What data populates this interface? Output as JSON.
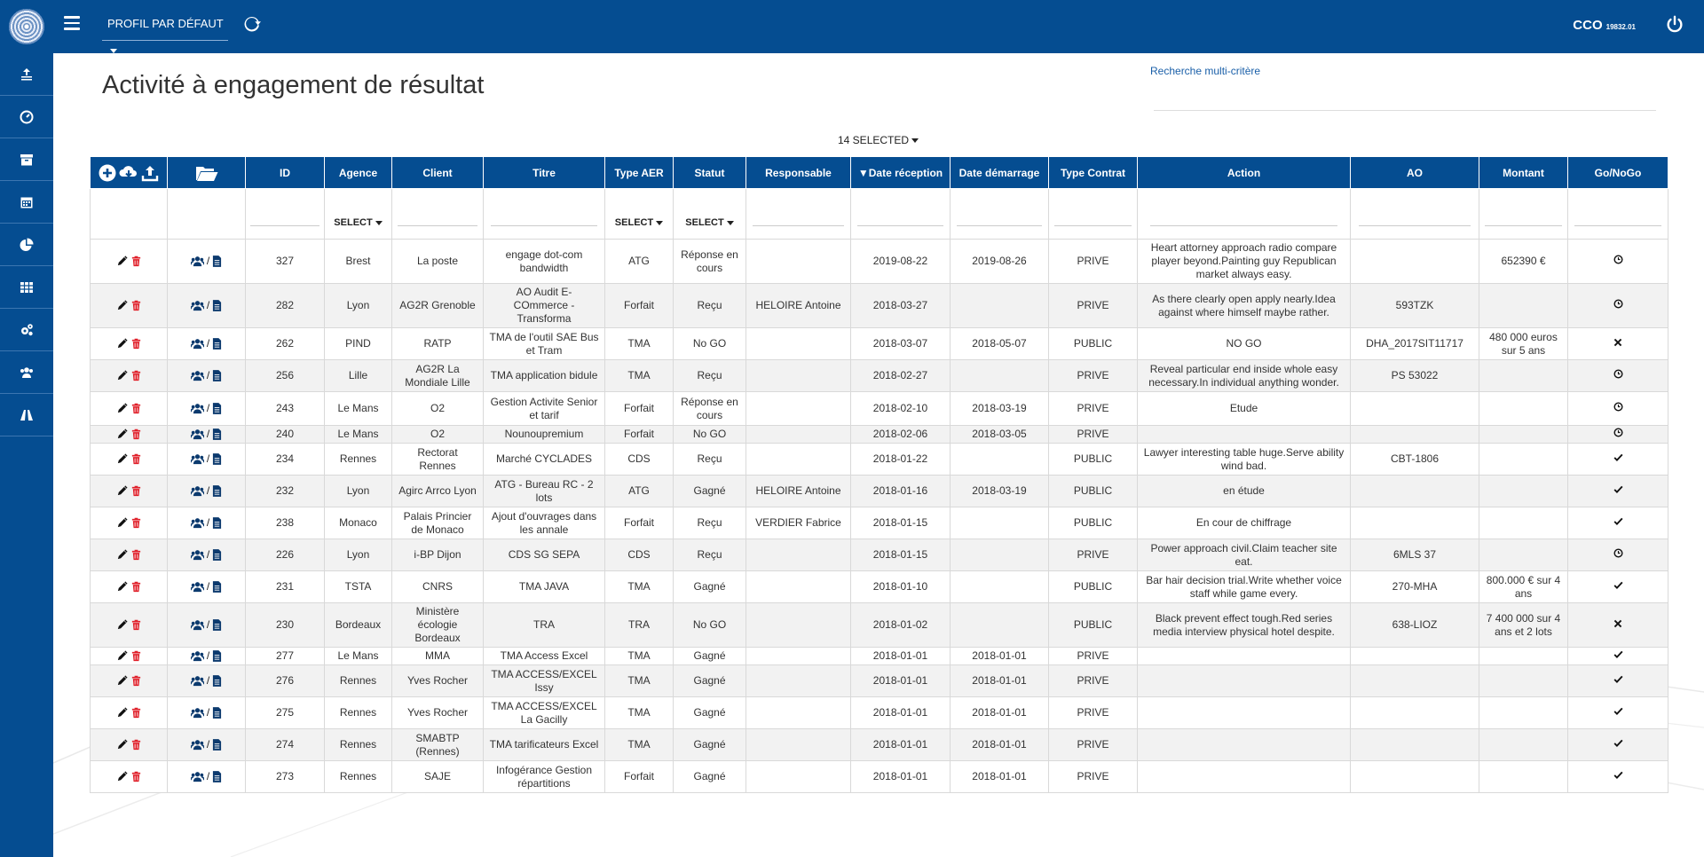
{
  "header": {
    "profile_label": "PROFIL PAR DÉFAUT",
    "user_name": "CCO",
    "user_code": "19832.01"
  },
  "page": {
    "title": "Activité à engagement de résultat",
    "search_link": "Recherche multi-critère",
    "selected_label": "14 SELECTED"
  },
  "sidebar": {
    "items": [
      "upload-stack-icon",
      "dashboard-icon",
      "archive-icon",
      "calendar-icon",
      "pie-chart-icon",
      "table-icon",
      "settings-icon",
      "users-icon",
      "road-icon"
    ]
  },
  "table": {
    "columns": [
      "",
      "",
      "ID",
      "Agence",
      "Client",
      "Titre",
      "Type AER",
      "Statut",
      "Responsable",
      "▼Date réception",
      "Date démarrage",
      "Type Contrat",
      "Action",
      "AO",
      "Montant",
      "Go/NoGo"
    ],
    "select_label": "SELECT",
    "rows": [
      {
        "id": "327",
        "agence": "Brest",
        "client": "La poste",
        "titre": "engage dot-com bandwidth",
        "type": "ATG",
        "statut": "Réponse en cours",
        "resp": "",
        "date_rec": "2019-08-22",
        "date_dem": "2019-08-26",
        "contrat": "PRIVE",
        "action": "Heart attorney approach radio compare player beyond.Painting guy Republican market always easy.",
        "ao": "",
        "montant": "652390 €",
        "go": "pending"
      },
      {
        "id": "282",
        "agence": "Lyon",
        "client": "AG2R Grenoble",
        "titre": "AO Audit E-COmmerce - Transforma",
        "type": "Forfait",
        "statut": "Reçu",
        "resp": "HELOIRE Antoine",
        "date_rec": "2018-03-27",
        "date_dem": "",
        "contrat": "PRIVE",
        "action": "As there clearly open apply nearly.Idea against where himself maybe rather.",
        "ao": "593TZK",
        "montant": "",
        "go": "pending"
      },
      {
        "id": "262",
        "agence": "PIND",
        "client": "RATP",
        "titre": "TMA de l'outil SAE Bus et Tram",
        "type": "TMA",
        "statut": "No GO",
        "resp": "",
        "date_rec": "2018-03-07",
        "date_dem": "2018-05-07",
        "contrat": "PUBLIC",
        "action": "NO GO",
        "ao": "DHA_2017SIT11717",
        "montant": "480 000 euros sur 5 ans",
        "go": "nogo"
      },
      {
        "id": "256",
        "agence": "Lille",
        "client": "AG2R La Mondiale Lille",
        "titre": "TMA application bidule",
        "type": "TMA",
        "statut": "Reçu",
        "resp": "",
        "date_rec": "2018-02-27",
        "date_dem": "",
        "contrat": "PRIVE",
        "action": "Reveal particular end inside whole easy necessary.In individual anything wonder.",
        "ao": "PS 53022",
        "montant": "",
        "go": "pending"
      },
      {
        "id": "243",
        "agence": "Le Mans",
        "client": "O2",
        "titre": "Gestion Activite Senior et tarif",
        "type": "Forfait",
        "statut": "Réponse en cours",
        "resp": "",
        "date_rec": "2018-02-10",
        "date_dem": "2018-03-19",
        "contrat": "PRIVE",
        "action": "Etude",
        "ao": "",
        "montant": "",
        "go": "pending"
      },
      {
        "id": "240",
        "agence": "Le Mans",
        "client": "O2",
        "titre": "Nounoupremium",
        "type": "Forfait",
        "statut": "No GO",
        "resp": "",
        "date_rec": "2018-02-06",
        "date_dem": "2018-03-05",
        "contrat": "PRIVE",
        "action": "",
        "ao": "",
        "montant": "",
        "go": "pending"
      },
      {
        "id": "234",
        "agence": "Rennes",
        "client": "Rectorat Rennes",
        "titre": "Marché CYCLADES",
        "type": "CDS",
        "statut": "Reçu",
        "resp": "",
        "date_rec": "2018-01-22",
        "date_dem": "",
        "contrat": "PUBLIC",
        "action": "Lawyer interesting table huge.Serve ability wind bad.",
        "ao": "CBT-1806",
        "montant": "",
        "go": "go"
      },
      {
        "id": "232",
        "agence": "Lyon",
        "client": "Agirc Arrco Lyon",
        "titre": "ATG - Bureau RC - 2 lots",
        "type": "ATG",
        "statut": "Gagné",
        "resp": "HELOIRE Antoine",
        "date_rec": "2018-01-16",
        "date_dem": "2018-03-19",
        "contrat": "PUBLIC",
        "action": "en étude",
        "ao": "",
        "montant": "",
        "go": "go"
      },
      {
        "id": "238",
        "agence": "Monaco",
        "client": "Palais Princier de Monaco",
        "titre": "Ajout d'ouvrages dans les annale",
        "type": "Forfait",
        "statut": "Reçu",
        "resp": "VERDIER Fabrice",
        "date_rec": "2018-01-15",
        "date_dem": "",
        "contrat": "PUBLIC",
        "action": "En cour de chiffrage",
        "ao": "",
        "montant": "",
        "go": "go"
      },
      {
        "id": "226",
        "agence": "Lyon",
        "client": "i-BP Dijon",
        "titre": "CDS SG SEPA",
        "type": "CDS",
        "statut": "Reçu",
        "resp": "",
        "date_rec": "2018-01-15",
        "date_dem": "",
        "contrat": "PRIVE",
        "action": "Power approach civil.Claim teacher site eat.",
        "ao": "6MLS 37",
        "montant": "",
        "go": "pending"
      },
      {
        "id": "231",
        "agence": "TSTA",
        "client": "CNRS",
        "titre": "TMA JAVA",
        "type": "TMA",
        "statut": "Gagné",
        "resp": "",
        "date_rec": "2018-01-10",
        "date_dem": "",
        "contrat": "PUBLIC",
        "action": "Bar hair decision trial.Write whether voice staff while game every.",
        "ao": "270-MHA",
        "montant": "800.000 € sur 4 ans",
        "go": "go"
      },
      {
        "id": "230",
        "agence": "Bordeaux",
        "client": "Ministère écologie Bordeaux",
        "titre": "TRA",
        "type": "TRA",
        "statut": "No GO",
        "resp": "",
        "date_rec": "2018-01-02",
        "date_dem": "",
        "contrat": "PUBLIC",
        "action": "Black prevent effect tough.Red series media interview physical hotel despite.",
        "ao": "638-LIOZ",
        "montant": "7 400 000 sur 4 ans et 2 lots",
        "go": "nogo"
      },
      {
        "id": "277",
        "agence": "Le Mans",
        "client": "MMA",
        "titre": "TMA Access Excel",
        "type": "TMA",
        "statut": "Gagné",
        "resp": "",
        "date_rec": "2018-01-01",
        "date_dem": "2018-01-01",
        "contrat": "PRIVE",
        "action": "",
        "ao": "",
        "montant": "",
        "go": "go"
      },
      {
        "id": "276",
        "agence": "Rennes",
        "client": "Yves Rocher",
        "titre": "TMA ACCESS/EXCEL Issy",
        "type": "TMA",
        "statut": "Gagné",
        "resp": "",
        "date_rec": "2018-01-01",
        "date_dem": "2018-01-01",
        "contrat": "PRIVE",
        "action": "",
        "ao": "",
        "montant": "",
        "go": "go"
      },
      {
        "id": "275",
        "agence": "Rennes",
        "client": "Yves Rocher",
        "titre": "TMA ACCESS/EXCEL La Gacilly",
        "type": "TMA",
        "statut": "Gagné",
        "resp": "",
        "date_rec": "2018-01-01",
        "date_dem": "2018-01-01",
        "contrat": "PRIVE",
        "action": "",
        "ao": "",
        "montant": "",
        "go": "go"
      },
      {
        "id": "274",
        "agence": "Rennes",
        "client": "SMABTP (Rennes)",
        "titre": "TMA tarificateurs Excel",
        "type": "TMA",
        "statut": "Gagné",
        "resp": "",
        "date_rec": "2018-01-01",
        "date_dem": "2018-01-01",
        "contrat": "PRIVE",
        "action": "",
        "ao": "",
        "montant": "",
        "go": "go"
      },
      {
        "id": "273",
        "agence": "Rennes",
        "client": "SAJE",
        "titre": "Infogérance Gestion répartitions",
        "type": "Forfait",
        "statut": "Gagné",
        "resp": "",
        "date_rec": "2018-01-01",
        "date_dem": "2018-01-01",
        "contrat": "PRIVE",
        "action": "",
        "ao": "",
        "montant": "",
        "go": "go"
      }
    ]
  }
}
